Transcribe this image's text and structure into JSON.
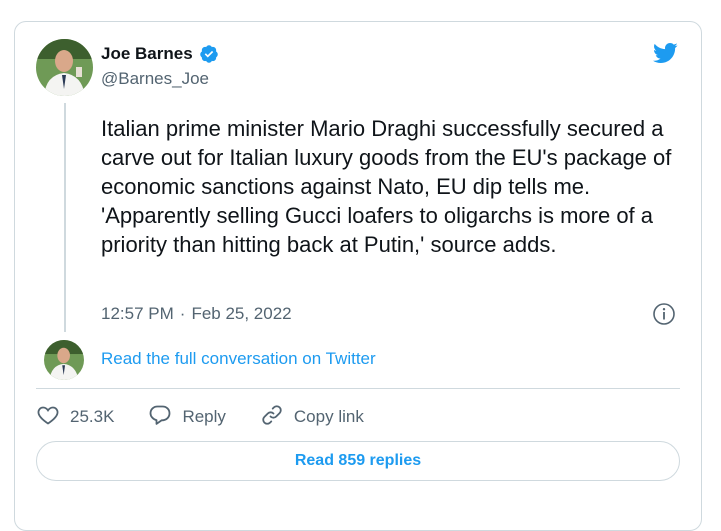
{
  "author": {
    "name": "Joe Barnes",
    "handle": "@Barnes_Joe",
    "verified_icon": "verified-badge-icon"
  },
  "platform_icon": "twitter-bird-icon",
  "tweet": {
    "text": "Italian prime minister Mario Draghi successfully secured a carve out for Italian luxury goods from the EU's package of economic sanctions against Nato, EU dip tells me. 'Apparently selling Gucci loafers to oligarchs is more of a priority than hitting back at Putin,' source adds.",
    "time": "12:57 PM",
    "separator": "·",
    "date": "Feb 25, 2022"
  },
  "conversation_link": "Read the full conversation on Twitter",
  "actions": {
    "like_count": "25.3K",
    "reply_label": "Reply",
    "copy_link_label": "Copy link"
  },
  "replies_button": "Read 859 replies",
  "colors": {
    "accent": "#1d9bf0",
    "muted": "#536471",
    "border": "#cfd9de",
    "text": "#0f1419"
  }
}
